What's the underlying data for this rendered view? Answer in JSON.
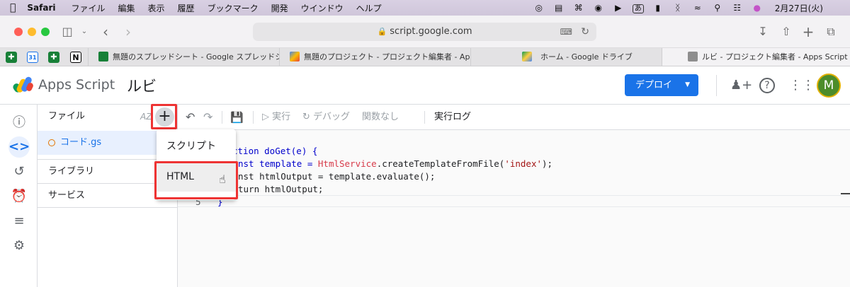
{
  "menubar": {
    "app": "Safari",
    "items": [
      "ファイル",
      "編集",
      "表示",
      "履歴",
      "ブックマーク",
      "開発",
      "ウインドウ",
      "ヘルプ"
    ],
    "ime": "あ",
    "date": "2月27日(火)"
  },
  "browser": {
    "url": "script.google.com",
    "tabs": [
      {
        "title": "無題のスプレッドシート - Google スプレッドシート"
      },
      {
        "title": "無題のプロジェクト - プロジェクト編集者 - Apps..."
      },
      {
        "title": "ホーム - Google ドライブ"
      },
      {
        "title": "ルビ - プロジェクト編集者 - Apps Script"
      }
    ],
    "pinned_labels": [
      "31"
    ]
  },
  "header": {
    "product": "Apps Script",
    "project": "ルビ",
    "deploy_label": "デプロイ",
    "avatar_initial": "M"
  },
  "files_panel": {
    "title": "ファイル",
    "sort_label": "AZ",
    "files": [
      {
        "name": "コード.gs"
      }
    ],
    "libraries_label": "ライブラリ",
    "services_label": "サービス"
  },
  "editor_toolbar": {
    "run_label": "実行",
    "debug_label": "デバッグ",
    "function_label": "関数なし",
    "log_label": "実行ログ"
  },
  "code": {
    "line1": "ction doGet(e) {",
    "line2_a": "nst template = ",
    "line2_b": "HtmlService",
    "line2_c": ".createTemplateFromFile(",
    "line2_d": "'index'",
    "line2_e": ");",
    "line3": "nst htmlOutput = template.evaluate();",
    "line4": "turn htmlOutput;",
    "line5_num": "5",
    "line5": "}"
  },
  "popup": {
    "options": [
      {
        "label": "スクリプト"
      },
      {
        "label": "HTML"
      }
    ]
  },
  "colors": {
    "accent": "#1a73e8",
    "highlight": "#e33333"
  }
}
